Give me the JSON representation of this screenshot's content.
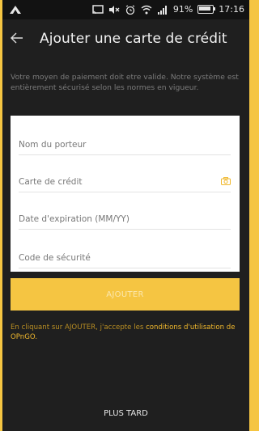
{
  "status_bar": {
    "battery": "91%",
    "time": "17:16"
  },
  "header": {
    "title": "Ajouter une carte de crédit"
  },
  "info_text": "Votre moyen de paiement doit etre valide. Notre système est entièrement sécurisé selon les normes en vigueur.",
  "form": {
    "cardholder_placeholder": "Nom du porteur",
    "card_number_placeholder": "Carte de crédit",
    "expiry_placeholder": "Date d'expiration (MM/YY)",
    "security_code_placeholder": "Code de sécurité"
  },
  "actions": {
    "add_label": "AJOUTER",
    "later_label": "PLUS TARD"
  },
  "terms": {
    "prefix": "En cliquant sur AJOUTER, j'accepte les ",
    "link": "conditions d'utilisation de OPnGO."
  },
  "colors": {
    "accent": "#f5c542",
    "background": "#1f1f1f",
    "card": "#ffffff"
  }
}
